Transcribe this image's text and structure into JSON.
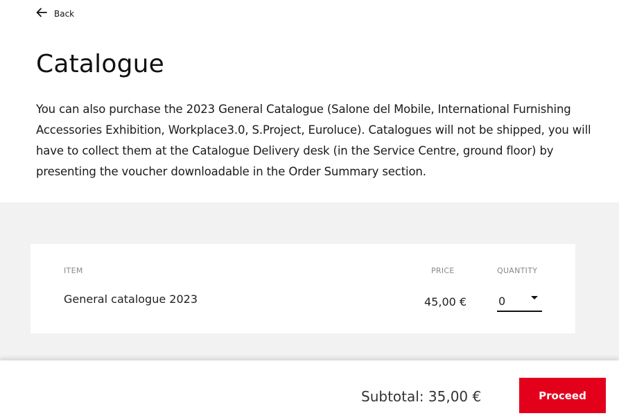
{
  "nav": {
    "back_label": "Back"
  },
  "page": {
    "title": "Catalogue",
    "description": "You can also purchase the 2023 General Catalogue (Salone del Mobile, International Furnishing Accessories Exhibition, Workplace3.0, S.Project, Euroluce). Catalogues will not be shipped, you will have to collect them at the Catalogue Delivery desk (in the Service Centre, ground floor) by presenting the voucher downloadable in the Order Summary section."
  },
  "table": {
    "headers": {
      "item": "ITEM",
      "price": "PRICE",
      "quantity": "QUANTITY"
    },
    "rows": [
      {
        "item": "General catalogue 2023",
        "price": "45,00 €",
        "quantity": "0"
      }
    ]
  },
  "footer": {
    "subtotal": "Subtotal: 35,00 €",
    "proceed_label": "Proceed"
  },
  "colors": {
    "accent": "#e3001b",
    "band": "#f2f2f2"
  },
  "icons": {
    "back": "arrow-left-icon",
    "quantity_dropdown": "caret-down-icon"
  }
}
